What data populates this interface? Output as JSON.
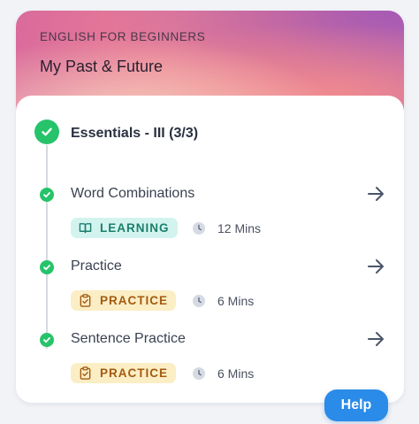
{
  "header": {
    "eyebrow": "ENGLISH FOR BEGINNERS",
    "title": "My Past & Future"
  },
  "section": {
    "title": "Essentials - III (3/3)",
    "status_icon": "check-circle-icon"
  },
  "items": [
    {
      "title": "Word Combinations",
      "badge": "LEARNING",
      "badge_icon": "book-open-icon",
      "duration": "12 Mins"
    },
    {
      "title": "Practice",
      "badge": "PRACTICE",
      "badge_icon": "clipboard-check-icon",
      "duration": "6 Mins"
    },
    {
      "title": "Sentence Practice",
      "badge": "PRACTICE",
      "badge_icon": "clipboard-check-icon",
      "duration": "6 Mins"
    }
  ],
  "help": {
    "label": "Help"
  },
  "colors": {
    "success": "#27c36a",
    "learning_bg": "#d3f4ee",
    "learning_text": "#1c7e6e",
    "practice_bg": "#fbeec5",
    "practice_text": "#a35a10",
    "help_button": "#2a8be8"
  }
}
